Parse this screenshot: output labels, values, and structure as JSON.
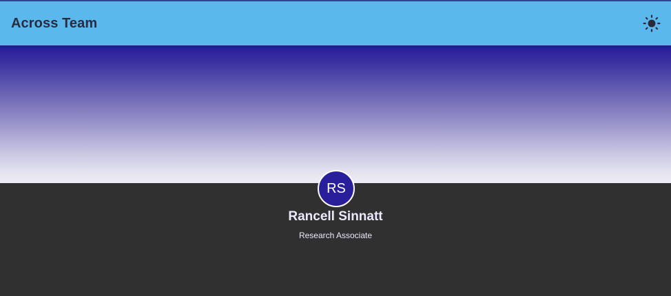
{
  "header": {
    "title": "Across Team",
    "theme_toggle_icon": "sun-icon"
  },
  "profile": {
    "initials": "RS",
    "name": "Rancell Sinnatt",
    "role": "Research Associate"
  },
  "colors": {
    "appbar": "#5bb8ec",
    "hero_top": "#261b9a",
    "hero_bottom": "#ebebf2",
    "avatar": "#2a1f9a",
    "background": "#303030",
    "text_light": "#ece9fb"
  }
}
